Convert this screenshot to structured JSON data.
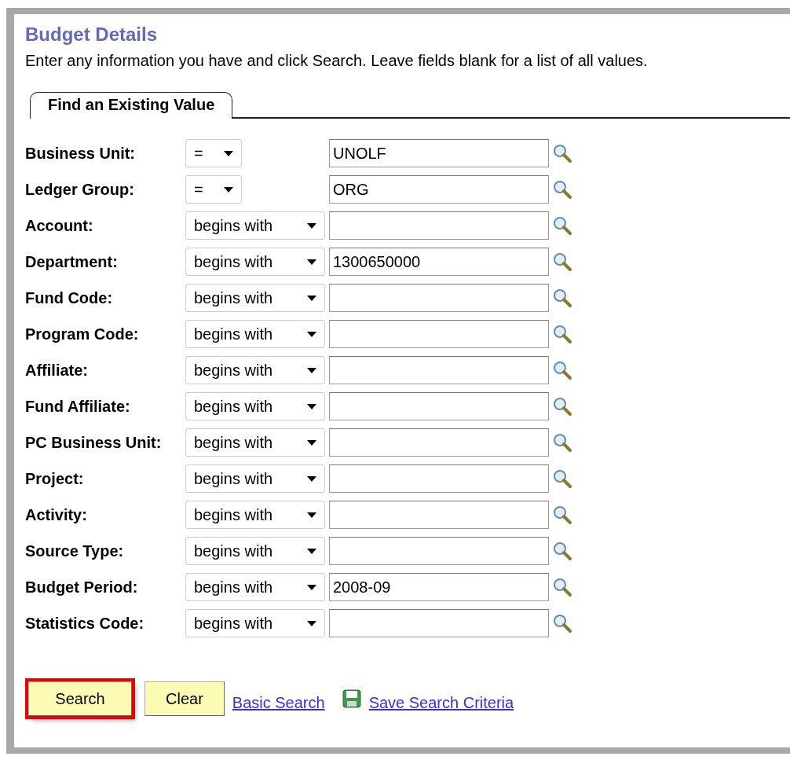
{
  "page": {
    "title": "Budget Details",
    "instructions": "Enter any information you have and click Search. Leave fields blank for a list of all values."
  },
  "tabs": [
    {
      "label": "Find an Existing Value",
      "selected": true
    }
  ],
  "fields": [
    {
      "label": "Business Unit:",
      "operator": "=",
      "value": "UNOLF"
    },
    {
      "label": "Ledger Group:",
      "operator": "=",
      "value": "ORG"
    },
    {
      "label": "Account:",
      "operator": "begins with"
    },
    {
      "label": "Department:",
      "operator": "begins with",
      "value": "1300650000"
    },
    {
      "label": "Fund Code:",
      "operator": "begins with"
    },
    {
      "label": "Program Code:",
      "operator": "begins with"
    },
    {
      "label": "Affiliate:",
      "operator": "begins with"
    },
    {
      "label": "Fund Affiliate:",
      "operator": "begins with"
    },
    {
      "label": "PC Business Unit:",
      "operator": "begins with"
    },
    {
      "label": "Project:",
      "operator": "begins with"
    },
    {
      "label": "Activity:",
      "operator": "begins with"
    },
    {
      "label": "Source Type:",
      "operator": "begins with"
    },
    {
      "label": "Budget Period:",
      "operator": "begins with",
      "value": "2008-09"
    },
    {
      "label": "Statistics Code:",
      "operator": "begins with"
    }
  ],
  "buttons": [
    {
      "label": "Search",
      "highlighted": true
    },
    {
      "label": "Clear",
      "highlighted": false
    }
  ],
  "links": [
    {
      "label": "Basic Search",
      "kind": "plain"
    },
    {
      "label": "Save Search Criteria",
      "kind": "save"
    }
  ]
}
